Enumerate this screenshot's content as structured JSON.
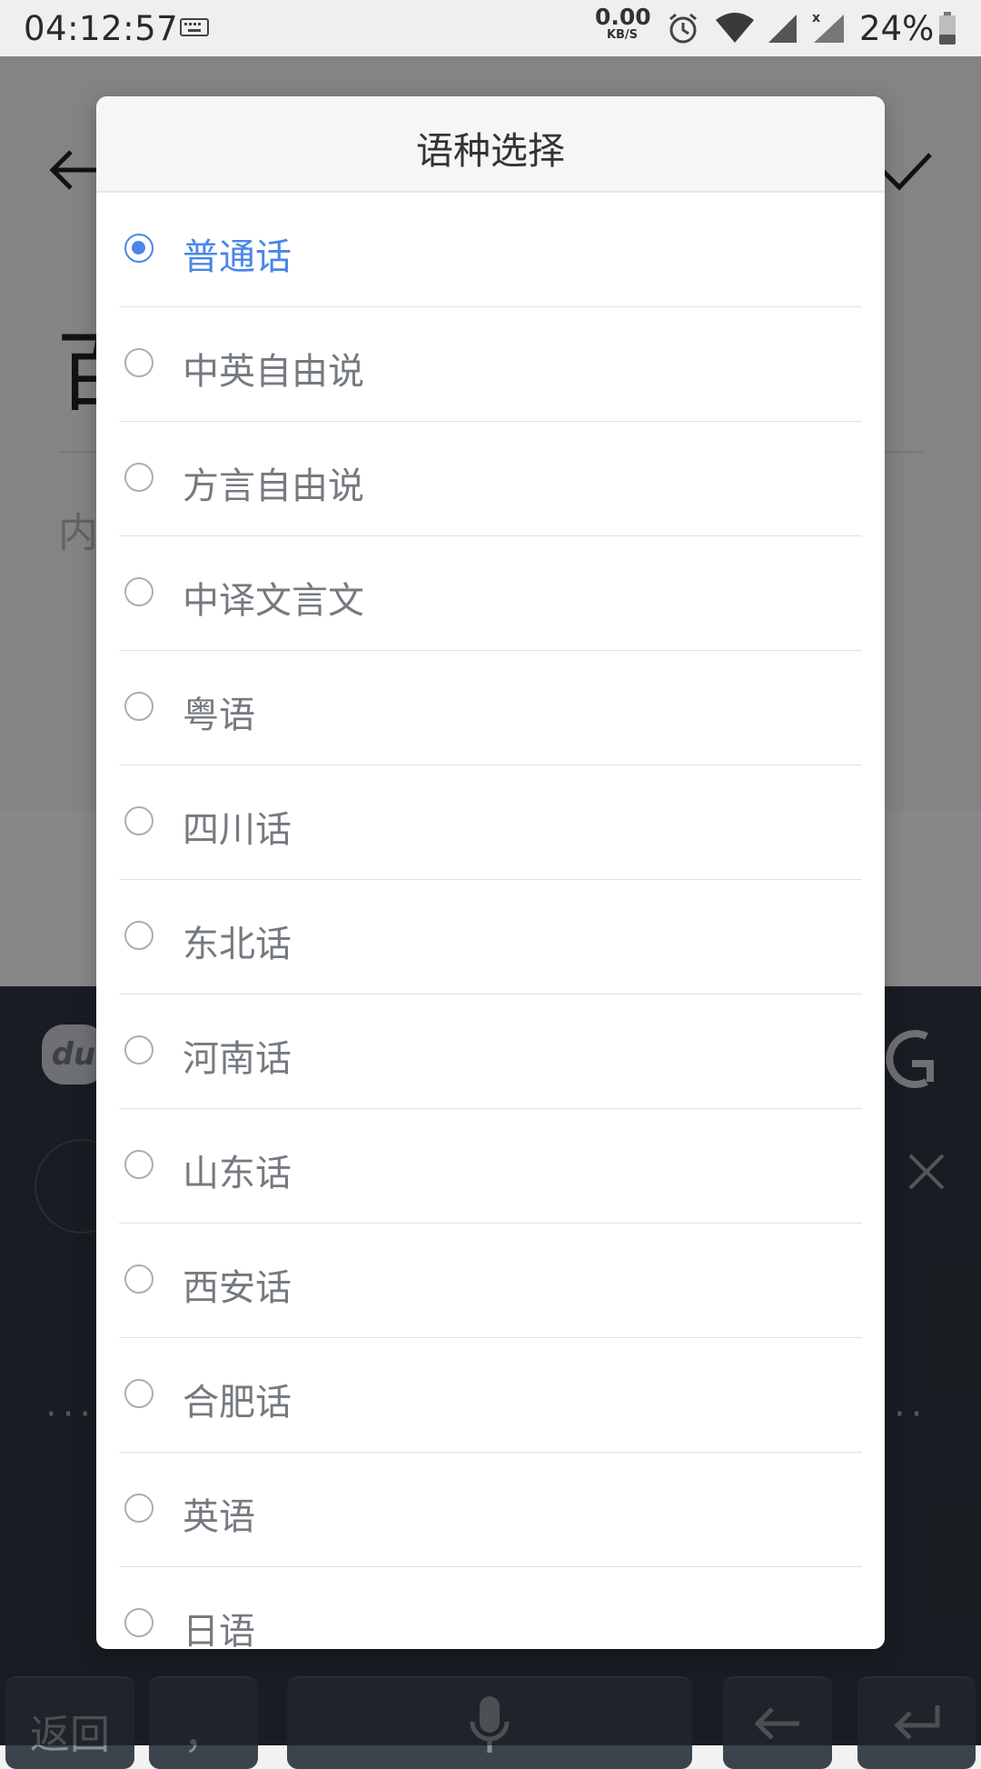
{
  "status_bar": {
    "time": "04:12:57",
    "net_speed_value": "0.00",
    "net_speed_unit": "KB/S",
    "battery_percent": "24%",
    "icons": [
      "keyboard-icon",
      "alarm-icon",
      "wifi-icon",
      "signal-icon",
      "signal-no-sim-icon",
      "battery-icon"
    ]
  },
  "background_app": {
    "title_partial": "百",
    "content_placeholder_partial": "内",
    "keyboard": {
      "back_key": "返回",
      "comma_key": "，"
    }
  },
  "dialog": {
    "title": "语种选择",
    "selected_index": 0,
    "options": [
      {
        "label": "普通话"
      },
      {
        "label": "中英自由说"
      },
      {
        "label": "方言自由说"
      },
      {
        "label": "中译文言文"
      },
      {
        "label": "粤语"
      },
      {
        "label": "四川话"
      },
      {
        "label": "东北话"
      },
      {
        "label": "河南话"
      },
      {
        "label": "山东话"
      },
      {
        "label": "西安话"
      },
      {
        "label": "合肥话"
      },
      {
        "label": "英语"
      },
      {
        "label": "日语"
      }
    ]
  },
  "colors": {
    "accent": "#4a86e8",
    "option_text": "#757a80",
    "dialog_header_bg": "#f6f6f6"
  }
}
